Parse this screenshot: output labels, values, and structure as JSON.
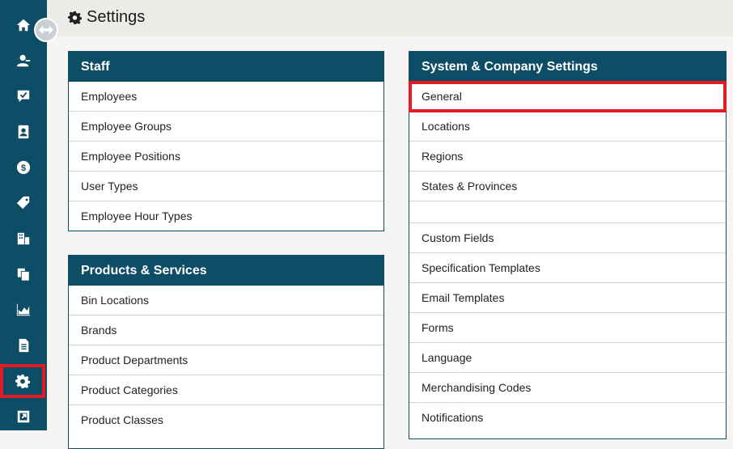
{
  "page": {
    "title": "Settings"
  },
  "sidebar": {
    "items": [
      {
        "icon": "home-icon"
      },
      {
        "icon": "users-icon"
      },
      {
        "icon": "checkmark-icon"
      },
      {
        "icon": "contact-card-icon"
      },
      {
        "icon": "dollar-icon"
      },
      {
        "icon": "tags-icon"
      },
      {
        "icon": "building-icon"
      },
      {
        "icon": "copy-icon"
      },
      {
        "icon": "area-chart-icon"
      },
      {
        "icon": "document-icon"
      },
      {
        "icon": "gear-icon",
        "selected": true
      },
      {
        "icon": "external-link-icon"
      }
    ],
    "toggle_icon": "expand-arrows-icon"
  },
  "panels": {
    "staff": {
      "title": "Staff",
      "items": [
        "Employees",
        "Employee Groups",
        "Employee Positions",
        "User Types",
        "Employee Hour Types"
      ]
    },
    "products": {
      "title": "Products & Services",
      "items": [
        "Bin Locations",
        "Brands",
        "Product Departments",
        "Product Categories",
        "Product Classes"
      ]
    },
    "system": {
      "title": "System & Company Settings",
      "items": [
        "General",
        "Locations",
        "Regions",
        "States & Provinces",
        "",
        "Custom Fields",
        "Specification Templates",
        "Email Templates",
        "Forms",
        "Language",
        "Merchandising Codes",
        "Notifications"
      ],
      "highlighted": "General"
    }
  },
  "colors": {
    "sidebar": "#0e4d66",
    "panel_header": "#0e4d66",
    "highlight": "#e31c24"
  }
}
